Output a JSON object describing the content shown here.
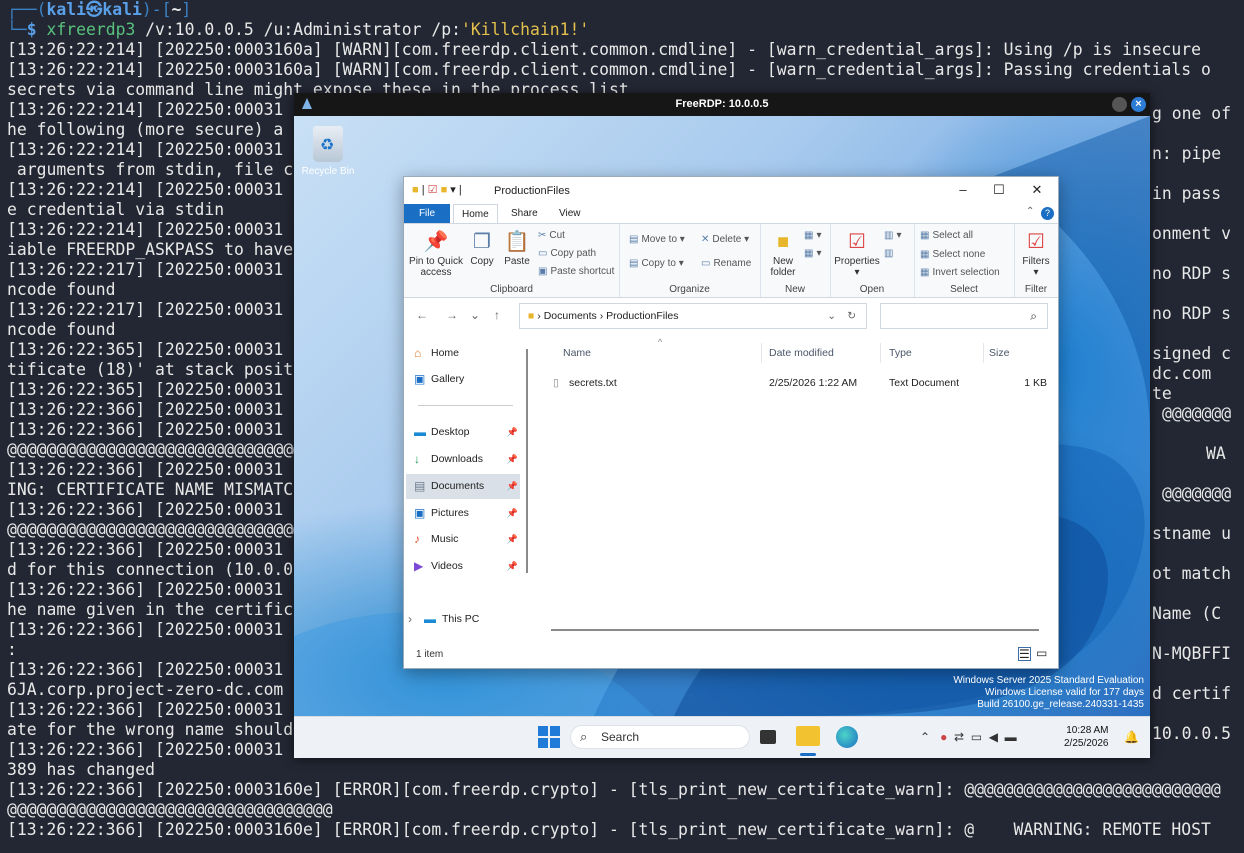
{
  "terminal": {
    "prompt_user": "kali㉿kali",
    "prompt_path": "~",
    "command_name": "xfreerdp3",
    "command_args": " /v:10.0.0.5 /u:Administrator /p:",
    "command_password": "'Killchain1!'",
    "lines": [
      "[13:26:22:214] [202250:0003160a] [WARN][com.freerdp.client.common.cmdline] - [warn_credential_args]: Using /p is insecure",
      "[13:26:22:214] [202250:0003160a] [WARN][com.freerdp.client.common.cmdline] - [warn_credential_args]: Passing credentials o",
      "secrets via command line might expose these in the process list",
      "[13:26:22:214] [202250:00031",
      "he following (more secure) a",
      "[13:26:22:214] [202250:00031",
      " arguments from stdin, file c",
      "[13:26:22:214] [202250:00031",
      "e credential via stdin",
      "[13:26:22:214] [202250:00031",
      "iable FREERDP_ASKPASS to have",
      "[13:26:22:217] [202250:00031",
      "ncode found",
      "[13:26:22:217] [202250:00031",
      "ncode found",
      "[13:26:22:365] [202250:00031",
      "tificate (18)' at stack posit",
      "[13:26:22:365] [202250:00031",
      "[13:26:22:366] [202250:00031",
      "[13:26:22:366] [202250:00031",
      "@@@@@@@@@@@@@@@@@@@@@@@@@@@@@@@@",
      "[13:26:22:366] [202250:00031",
      "ING: CERTIFICATE NAME MISMATC",
      "[13:26:22:366] [202250:00031",
      "@@@@@@@@@@@@@@@@@@@@@@@@@@@@@@@@",
      "[13:26:22:366] [202250:00031",
      "d for this connection (10.0.0",
      "[13:26:22:366] [202250:00031",
      "he name given in the certific",
      "[13:26:22:366] [202250:00031",
      ":",
      "[13:26:22:366] [202250:00031",
      "6JA.corp.project-zero-dc.com",
      "[13:26:22:366] [202250:00031",
      "ate for the wrong name should",
      "[13:26:22:366] [202250:00031",
      "389 has changed",
      "[13:26:22:366] [202250:0003160e] [ERROR][com.freerdp.crypto] - [tls_print_new_certificate_warn]: @@@@@@@@@@@@@@@@@@@@@@@@@@",
      "@@@@@@@@@@@@@@@@@@@@@@@@@@@@@@@@@",
      "[13:26:22:366] [202250:0003160e] [ERROR][com.freerdp.crypto] - [tls_print_new_certificate_warn]: @    WARNING: REMOTE HOST"
    ],
    "right_fragments": [
      "g one of",
      "n: pipe",
      "in pass",
      "onment v",
      "no RDP s",
      "no RDP s",
      "signed c",
      "dc.com",
      "te",
      "@@@@@@@",
      "WA",
      "@@@@@@@",
      "stname u",
      "ot match",
      "Name (C",
      "N-MQBFFI",
      "d certif",
      "10.0.0.5"
    ]
  },
  "rdp": {
    "title": "FreeRDP: 10.0.0.5",
    "recycle_bin_label": "Recycle Bin",
    "watermark": [
      "Windows Server 2025 Standard Evaluation",
      "Windows License valid for 177 days",
      "Build 26100.ge_release.240331-1435"
    ],
    "taskbar": {
      "search_label": "Search",
      "clock_time": "10:28 AM",
      "clock_date": "2/25/2026"
    }
  },
  "explorer": {
    "title": "ProductionFiles",
    "tabs": [
      "File",
      "Home",
      "Share",
      "View"
    ],
    "ribbon": {
      "pin_label": "Pin to Quick access",
      "copy_label": "Copy",
      "paste_label": "Paste",
      "cut_label": "Cut",
      "copy_path_label": "Copy path",
      "paste_shortcut_label": "Paste shortcut",
      "clipboard_group": "Clipboard",
      "move_to_label": "Move to",
      "copy_to_label": "Copy to",
      "delete_label": "Delete",
      "rename_label": "Rename",
      "organize_group": "Organize",
      "new_folder_label": "New folder",
      "new_group": "New",
      "properties_label": "Properties",
      "open_group": "Open",
      "select_all_label": "Select all",
      "select_none_label": "Select none",
      "invert_selection_label": "Invert selection",
      "select_group": "Select",
      "filters_label": "Filters",
      "filter_group": "Filter"
    },
    "address": {
      "crumb1": "Documents",
      "crumb2": "ProductionFiles"
    },
    "nav": {
      "home": "Home",
      "gallery": "Gallery",
      "desktop": "Desktop",
      "downloads": "Downloads",
      "documents": "Documents",
      "pictures": "Pictures",
      "music": "Music",
      "videos": "Videos",
      "this_pc": "This PC"
    },
    "columns": {
      "name": "Name",
      "date": "Date modified",
      "type": "Type",
      "size": "Size"
    },
    "files": [
      {
        "name": "secrets.txt",
        "date": "2/25/2026 1:22 AM",
        "type": "Text Document",
        "size": "1 KB"
      }
    ],
    "status": "1 item"
  }
}
